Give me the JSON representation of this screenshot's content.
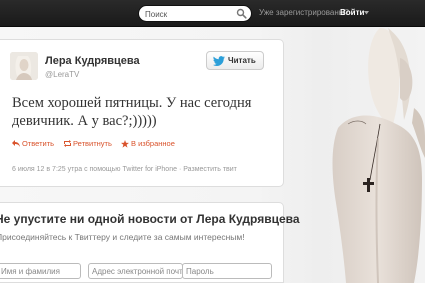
{
  "topbar": {
    "search_placeholder": "Поиск",
    "already_registered": "Уже зарегистрированы?",
    "signin_label": "Войти"
  },
  "tweet": {
    "author_name": "Лера Кудрявцева",
    "author_handle": "@LeraTV",
    "follow_label": "Читать",
    "text": "Всем хорошей пятницы. У нас сегодня девичник. А у вас?;)))))",
    "actions": {
      "reply": "Ответить",
      "retweet": "Ретвитнуть",
      "favorite": "В избранное"
    },
    "meta_time": "6 июля 12 в 7:25 утра с помощью",
    "meta_source": "Twitter for iPhone",
    "meta_embed": "Разместить твит"
  },
  "signup": {
    "title": "Не упустите ни одной новости от Лера Кудрявцева",
    "subtitle": "Присоединяйтесь к Твиттеру и следите за самым интересным!",
    "name_placeholder": "Имя и фамилия",
    "email_placeholder": "Адрес электронной почты",
    "password_placeholder": "Пароль"
  },
  "colors": {
    "topbar": "#1f1f1f",
    "accent_orange": "#d9532c",
    "twitter_blue": "#2b9fd9"
  },
  "icons": [
    "search-icon",
    "chevron-down-icon",
    "twitter-bird-icon",
    "reply-icon",
    "retweet-icon",
    "star-icon"
  ]
}
